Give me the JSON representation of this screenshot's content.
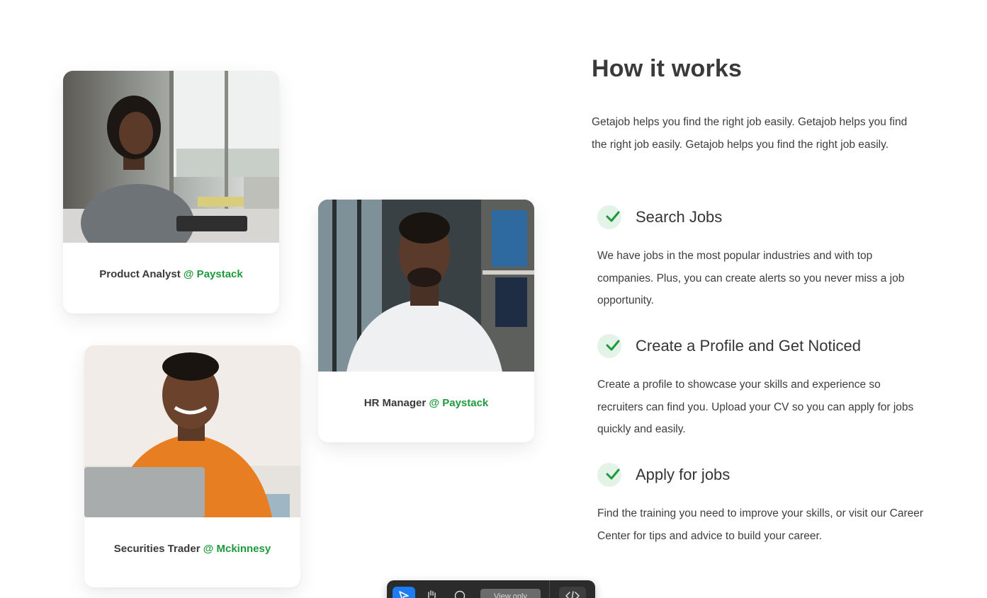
{
  "cards": [
    {
      "role": "Product Analyst",
      "company": "@ Paystack"
    },
    {
      "role": "HR Manager",
      "company": "@ Paystack"
    },
    {
      "role": "Securities Trader",
      "company": "@ Mckinnesy"
    }
  ],
  "section": {
    "title": "How it works",
    "intro": "Getajob helps you find the right job easily. Getajob helps you find the right job easily. Getajob helps you find the right job easily.",
    "steps": [
      {
        "title": "Search Jobs",
        "text": "We have jobs in the most popular industries and with top companies. Plus, you can create alerts so you never miss a job opportunity."
      },
      {
        "title": "Create a Profile and Get Noticed",
        "text": "Create a profile to showcase your skills and experience so recruiters can find you. Upload your CV so you can apply for jobs quickly and easily."
      },
      {
        "title": "Apply for jobs",
        "text": "Find the training you need to improve your skills, or visit our Career Center for tips and advice to build your career."
      }
    ]
  },
  "toolbar": {
    "view_label": "View only",
    "icons": [
      "pointer-icon",
      "hand-icon",
      "comment-icon",
      "code-icon"
    ]
  },
  "colors": {
    "accent": "#1e9a3c",
    "check_bg": "#e4f3e7",
    "text": "#3a3a3a",
    "toolbar_bg": "#2b2b2b",
    "toolbar_active": "#1e7cf2"
  }
}
